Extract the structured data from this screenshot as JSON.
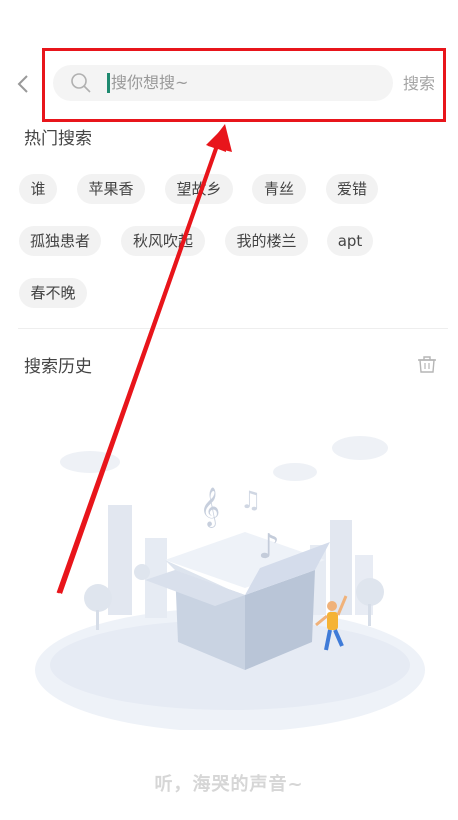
{
  "header": {
    "back_icon": "chevron-left-icon",
    "search_icon": "search-icon",
    "search_placeholder": "搜你想搜~",
    "search_button_label": "搜索"
  },
  "hot_search": {
    "title": "热门搜索",
    "tags": [
      "谁",
      "苹果香",
      "望故乡",
      "青丝",
      "爱错",
      "孤独患者",
      "秋风吹起",
      "我的楼兰",
      "apt",
      "春不晚"
    ]
  },
  "history": {
    "title": "搜索历史",
    "clear_icon": "trash-icon",
    "empty_text": "听，海哭的声音~"
  },
  "annotation": {
    "box_color": "#e8151b",
    "arrow_color": "#e8151b"
  }
}
